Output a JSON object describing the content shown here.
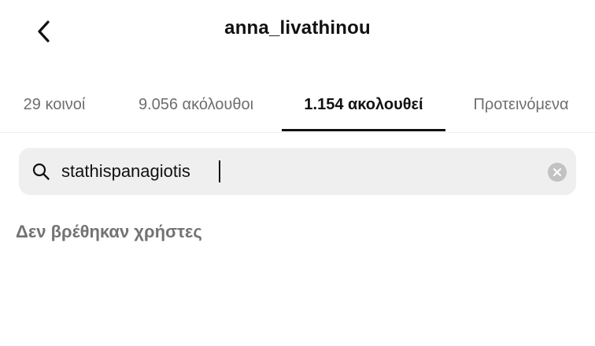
{
  "header": {
    "title": "anna_livathinou",
    "back_icon": "chevron-left-icon"
  },
  "tabs": [
    {
      "label": "29 κοινοί",
      "active": false
    },
    {
      "label": "9.056 ακόλουθοι",
      "active": false
    },
    {
      "label": "1.154 ακολουθεί",
      "active": true
    },
    {
      "label": "Προτεινόμενα",
      "active": false
    }
  ],
  "search": {
    "value": "stathispanagiotis",
    "icon": "search-icon",
    "clear_icon": "clear-icon"
  },
  "results": {
    "empty_message": "Δεν βρέθηκαν χρήστες"
  },
  "colors": {
    "text": "#111111",
    "muted": "#6e6e6e",
    "search_bg": "#efeff0",
    "clear_bg": "#c2c2c4"
  }
}
